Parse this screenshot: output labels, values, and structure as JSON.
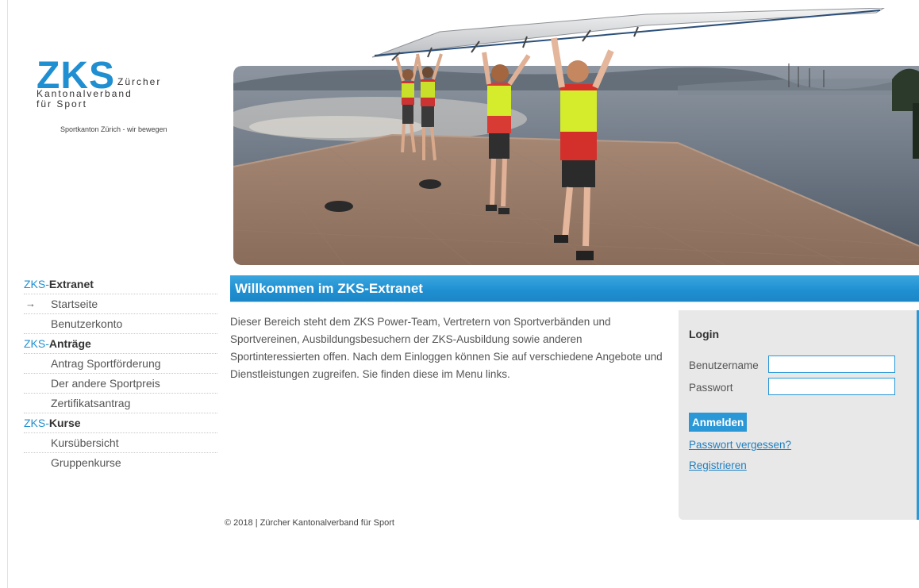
{
  "logo": {
    "mark": "ZKS",
    "line1": "Zürcher",
    "line2": "Kantonalverband",
    "line3": "für Sport",
    "tagline": "Sportkanton Zürich - wir bewegen",
    "color": "#1f8fd1"
  },
  "hero": {
    "icon": "rowing-team-photo"
  },
  "sidebar": {
    "sections": [
      {
        "prefix": "ZKS-",
        "title": "Extranet",
        "items": [
          {
            "label": "Startseite",
            "active": true,
            "marker": "→"
          },
          {
            "label": "Benutzerkonto"
          }
        ]
      },
      {
        "prefix": "ZKS-",
        "title": "Anträge",
        "items": [
          {
            "label": "Antrag Sportförderung"
          },
          {
            "label": "Der andere Sportpreis"
          },
          {
            "label": "Zertifikatsantrag"
          }
        ]
      },
      {
        "prefix": "ZKS-",
        "title": "Kurse",
        "items": [
          {
            "label": "Kursübersicht"
          },
          {
            "label": "Gruppenkurse"
          }
        ]
      }
    ]
  },
  "main": {
    "title": "Willkommen im ZKS-Extranet",
    "intro": "Dieser Bereich steht dem ZKS Power-Team, Vertretern von Sportverbänden und Sportvereinen, Ausbildungsbesuchern der ZKS-Ausbildung sowie anderen Sportinteressierten offen. Nach dem Einloggen können Sie auf verschiedene Angebote und Dienstleistungen zugreifen. Sie finden diese im Menu links."
  },
  "login": {
    "title": "Login",
    "username_label": "Benutzername",
    "username_value": "",
    "password_label": "Passwort",
    "password_value": "",
    "submit_label": "Anmelden",
    "forgot_link": "Passwort vergessen?",
    "register_link": "Registrieren"
  },
  "footer": {
    "text": "© 2018 | Zürcher Kantonalverband für Sport"
  },
  "colors": {
    "accent": "#1f8fd1",
    "link": "#1f7fc0",
    "panel": "#e8e8e8"
  }
}
